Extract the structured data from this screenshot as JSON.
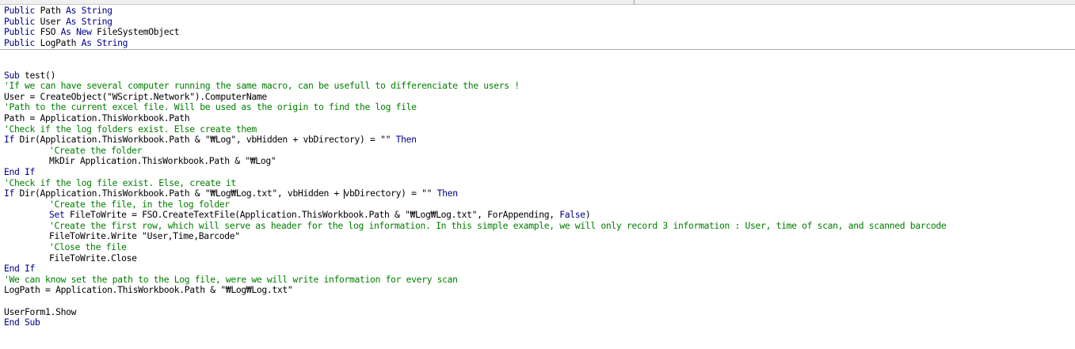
{
  "lines": [
    [
      {
        "t": "Public ",
        "k": "kw"
      },
      {
        "t": "Path ",
        "k": "tx"
      },
      {
        "t": "As String",
        "k": "kw"
      }
    ],
    [
      {
        "t": "Public ",
        "k": "kw"
      },
      {
        "t": "User ",
        "k": "tx"
      },
      {
        "t": "As String",
        "k": "kw"
      }
    ],
    [
      {
        "t": "Public ",
        "k": "kw"
      },
      {
        "t": "FSO ",
        "k": "tx"
      },
      {
        "t": "As New ",
        "k": "kw"
      },
      {
        "t": "FileSystemObject",
        "k": "tx"
      }
    ],
    [
      {
        "t": "Public ",
        "k": "kw"
      },
      {
        "t": "LogPath ",
        "k": "tx"
      },
      {
        "t": "As String",
        "k": "kw"
      }
    ],
    [],
    [],
    [
      {
        "t": "Sub ",
        "k": "kw"
      },
      {
        "t": "test()",
        "k": "tx"
      }
    ],
    [
      {
        "t": "'If we can have several computer running the same macro, can be usefull to differenciate the users !",
        "k": "cm"
      }
    ],
    [
      {
        "t": "User = CreateObject(\"WScript.Network\").ComputerName",
        "k": "tx"
      }
    ],
    [
      {
        "t": "'Path to the current excel file. Will be used as the origin to find the log file",
        "k": "cm"
      }
    ],
    [
      {
        "t": "Path = Application.ThisWorkbook.Path",
        "k": "tx"
      }
    ],
    [
      {
        "t": "'Check if the log folders exist. Else create them",
        "k": "cm"
      }
    ],
    [
      {
        "t": "If ",
        "k": "kw"
      },
      {
        "t": "Dir(Application.ThisWorkbook.Path & \"₩Log\", vbHidden + vbDirectory) = \"\" ",
        "k": "tx"
      },
      {
        "t": "Then",
        "k": "kw"
      }
    ],
    [
      {
        "t": "'Create the folder",
        "k": "cm",
        "indent": true
      }
    ],
    [
      {
        "t": "MkDir Application.ThisWorkbook.Path & \"₩Log\"",
        "k": "tx",
        "indent": true
      }
    ],
    [
      {
        "t": "End If",
        "k": "kw"
      }
    ],
    [
      {
        "t": "'Check if the log file exist. Else, create it",
        "k": "cm"
      }
    ],
    [
      {
        "t": "If ",
        "k": "kw"
      },
      {
        "t": "Dir(Application.ThisWorkbook.Path & \"₩Log₩Log.txt\", vbHidden + ",
        "k": "tx"
      },
      {
        "t": "",
        "k": "caret"
      },
      {
        "t": "vbDirectory) = \"\" ",
        "k": "tx"
      },
      {
        "t": "Then",
        "k": "kw"
      }
    ],
    [
      {
        "t": "'Create the file, in the log folder",
        "k": "cm",
        "indent": true
      }
    ],
    [
      {
        "t": "Set ",
        "k": "kw",
        "indent": true
      },
      {
        "t": "FileToWrite = FSO.CreateTextFile(Application.ThisWorkbook.Path & \"₩Log₩Log.txt\", ForAppending, ",
        "k": "tx"
      },
      {
        "t": "False",
        "k": "kw"
      },
      {
        "t": ")",
        "k": "tx"
      }
    ],
    [
      {
        "t": "'Create the first row, which will serve as header for the log information. In this simple example, we will only record 3 information : User, time of scan, and scanned barcode",
        "k": "cm",
        "indent": true
      }
    ],
    [
      {
        "t": "FileToWrite.Write \"User,Time,Barcode\"",
        "k": "tx",
        "indent": true
      }
    ],
    [
      {
        "t": "'Close the file",
        "k": "cm",
        "indent": true
      }
    ],
    [
      {
        "t": "FileToWrite.Close",
        "k": "tx",
        "indent": true
      }
    ],
    [
      {
        "t": "End If",
        "k": "kw"
      }
    ],
    [
      {
        "t": "'We can know set the path to the Log file, were we will write information for every scan",
        "k": "cm"
      }
    ],
    [
      {
        "t": "LogPath = Application.ThisWorkbook.Path & \"₩Log₩Log.txt\"",
        "k": "tx"
      }
    ],
    [],
    [
      {
        "t": "UserForm1.Show",
        "k": "tx"
      }
    ],
    [
      {
        "t": "End Sub",
        "k": "kw"
      }
    ]
  ]
}
